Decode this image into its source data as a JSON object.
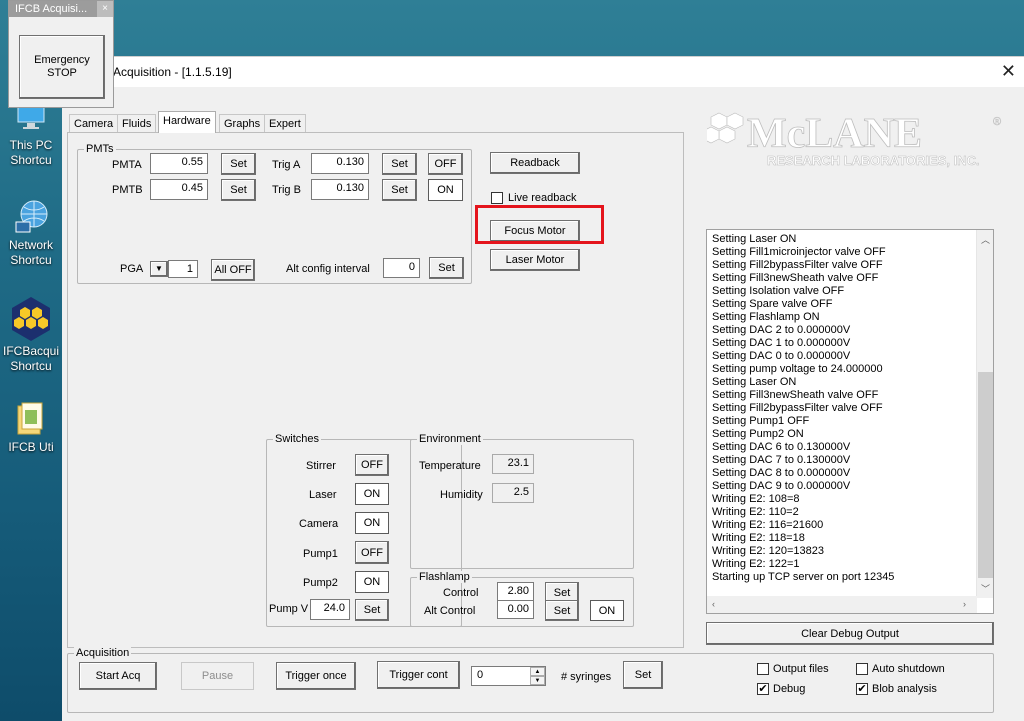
{
  "mini_window": {
    "title": "IFCB Acquisi...",
    "close": "×",
    "emergency_line1": "Emergency",
    "emergency_line2": "STOP"
  },
  "desktop_icons": [
    {
      "line1": "This PC",
      "line2": "Shortcu"
    },
    {
      "line1": "Network",
      "line2": "Shortcu"
    },
    {
      "line1": "IFCBacqui",
      "line2": "Shortcu"
    },
    {
      "line1": "IFCB Uti",
      "line2": ""
    }
  ],
  "window": {
    "title": "Acquisition - [1.1.5.19]",
    "close": "✕"
  },
  "tabs": [
    {
      "label": "Camera"
    },
    {
      "label": "Fluids"
    },
    {
      "label": "Hardware"
    },
    {
      "label": "Graphs"
    },
    {
      "label": "Expert"
    }
  ],
  "pmts": {
    "group_label": "PMTs",
    "pmta_label": "PMTA",
    "pmta_value": "0.55",
    "pmtb_label": "PMTB",
    "pmtb_value": "0.45",
    "set_label": "Set",
    "trig_a_label": "Trig A",
    "trig_a_value": "0.130",
    "trig_a_state": "OFF",
    "trig_b_label": "Trig B",
    "trig_b_value": "0.130",
    "trig_b_state": "ON",
    "pga_label": "PGA",
    "pga_value": "1",
    "all_off_label": "All OFF",
    "alt_config_label": "Alt config interval",
    "alt_config_value": "0"
  },
  "right_buttons": {
    "readback": "Readback",
    "live_readback": "Live readback",
    "focus_motor": "Focus Motor",
    "laser_motor": "Laser Motor"
  },
  "switches": {
    "group_label": "Switches",
    "rows": [
      {
        "label": "Stirrer",
        "state": "OFF"
      },
      {
        "label": "Laser",
        "state": "ON"
      },
      {
        "label": "Camera",
        "state": "ON"
      },
      {
        "label": "Pump1",
        "state": "OFF"
      },
      {
        "label": "Pump2",
        "state": "ON"
      }
    ],
    "pump_v_label": "Pump V",
    "pump_v_value": "24.0",
    "set_label": "Set"
  },
  "environment": {
    "group_label": "Environment",
    "temperature_label": "Temperature",
    "temperature_value": "23.1",
    "humidity_label": "Humidity",
    "humidity_value": "2.5"
  },
  "flashlamp": {
    "group_label": "Flashlamp",
    "control_label": "Control",
    "control_value": "2.80",
    "alt_control_label": "Alt Control",
    "alt_control_value": "0.00",
    "set_label": "Set",
    "state": "ON"
  },
  "debug_lines": [
    "Setting Laser ON",
    "Setting Fill1microinjector valve OFF",
    "Setting Fill2bypassFilter valve OFF",
    "Setting Fill3newSheath valve OFF",
    "Setting Isolation valve OFF",
    "Setting Spare valve OFF",
    "Setting Flashlamp ON",
    "Setting DAC 2 to 0.000000V",
    "Setting DAC 1 to 0.000000V",
    "Setting DAC 0 to 0.000000V",
    "Setting pump voltage to 24.000000",
    "Setting Laser ON",
    "Setting Fill3newSheath valve OFF",
    "Setting Fill2bypassFilter valve OFF",
    "Setting Pump1 OFF",
    "Setting Pump2 ON",
    "Setting DAC 6 to 0.130000V",
    "Setting DAC 7 to 0.130000V",
    "Setting DAC 8 to 0.000000V",
    "Setting DAC 9 to 0.000000V",
    "Writing E2: 108=8",
    "Writing E2: 110=2",
    "Writing E2: 116=21600",
    "Writing E2: 118=18",
    "Writing E2: 120=13823",
    "Writing E2: 122=1",
    "Starting up TCP server on port 12345"
  ],
  "clear_debug_label": "Clear Debug Output",
  "logo": {
    "name": "McLANE",
    "tagline": "RESEARCH LABORATORIES, INC.",
    "reg": "®"
  },
  "acquisition": {
    "group_label": "Acquisition",
    "start_acq": "Start Acq",
    "pause": "Pause",
    "trigger_once": "Trigger once",
    "trigger_cont": "Trigger cont",
    "syringes_value": "0",
    "syringes_label": "# syringes",
    "set_label": "Set"
  },
  "options": {
    "output_files": "Output files",
    "auto_shutdown": "Auto shutdown",
    "debug": "Debug",
    "blob_analysis": "Blob analysis"
  },
  "colors": {
    "highlight": "#e4141c",
    "window_bg": "#f0f0f0"
  }
}
